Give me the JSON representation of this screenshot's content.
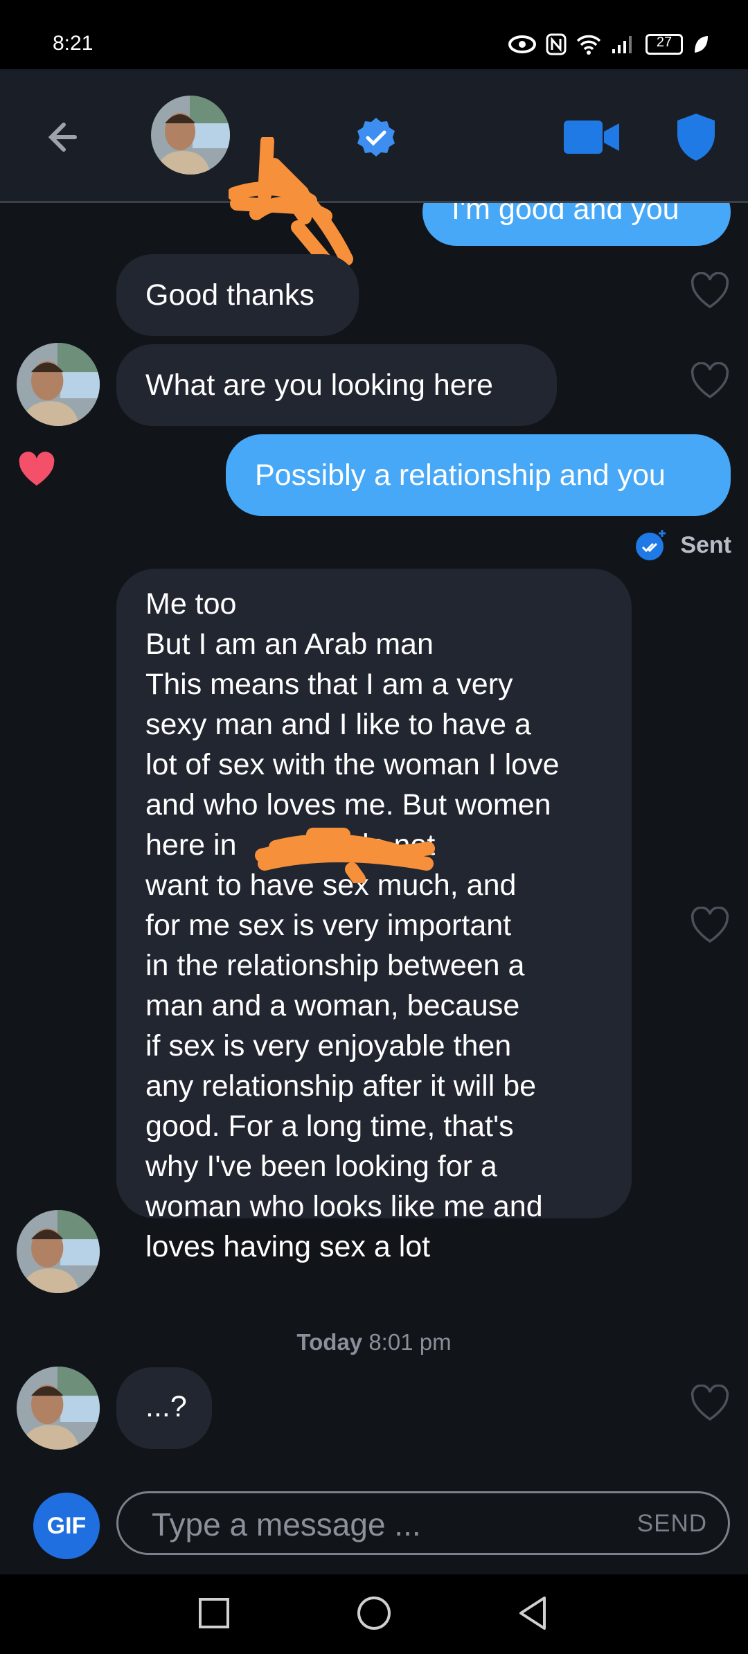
{
  "status_bar": {
    "time": "8:21",
    "battery": "27"
  },
  "header": {
    "contact_name_redacted": true
  },
  "messages": [
    {
      "id": "m0",
      "direction": "outgoing",
      "text": "I'm good and you"
    },
    {
      "id": "m1",
      "direction": "incoming",
      "text": "Good thanks"
    },
    {
      "id": "m2",
      "direction": "incoming",
      "text": "What are you looking here"
    },
    {
      "id": "m3",
      "direction": "outgoing",
      "text": "Possibly a relationship and you",
      "status": "Sent",
      "liked": true
    },
    {
      "id": "m4",
      "direction": "incoming",
      "lines": [
        "Me too",
        "But I am an Arab man",
        "This means that I am a very",
        "sexy man and I like to have a",
        "lot of sex with the woman I love",
        "and who loves me. But women",
        "here in              do not",
        "want to have sex much, and",
        "for me sex is very important",
        "in the relationship between a",
        "man and a woman, because",
        "if sex is very enjoyable then",
        "any relationship after it will be",
        "good. For a long time, that's",
        "why I've been looking for a",
        "woman who looks like me and",
        "loves having sex a lot"
      ]
    },
    {
      "id": "m5",
      "direction": "incoming",
      "text": "...?"
    }
  ],
  "timestamp": {
    "day": "Today",
    "time": "8:01 pm"
  },
  "composer": {
    "gif_label": "GIF",
    "placeholder": "Type a message ...",
    "send_label": "SEND"
  },
  "colors": {
    "accent": "#46a8f7",
    "bubble_in": "#222630",
    "background": "#111419",
    "redaction": "#f7903a",
    "heart_liked": "#f4506a"
  }
}
